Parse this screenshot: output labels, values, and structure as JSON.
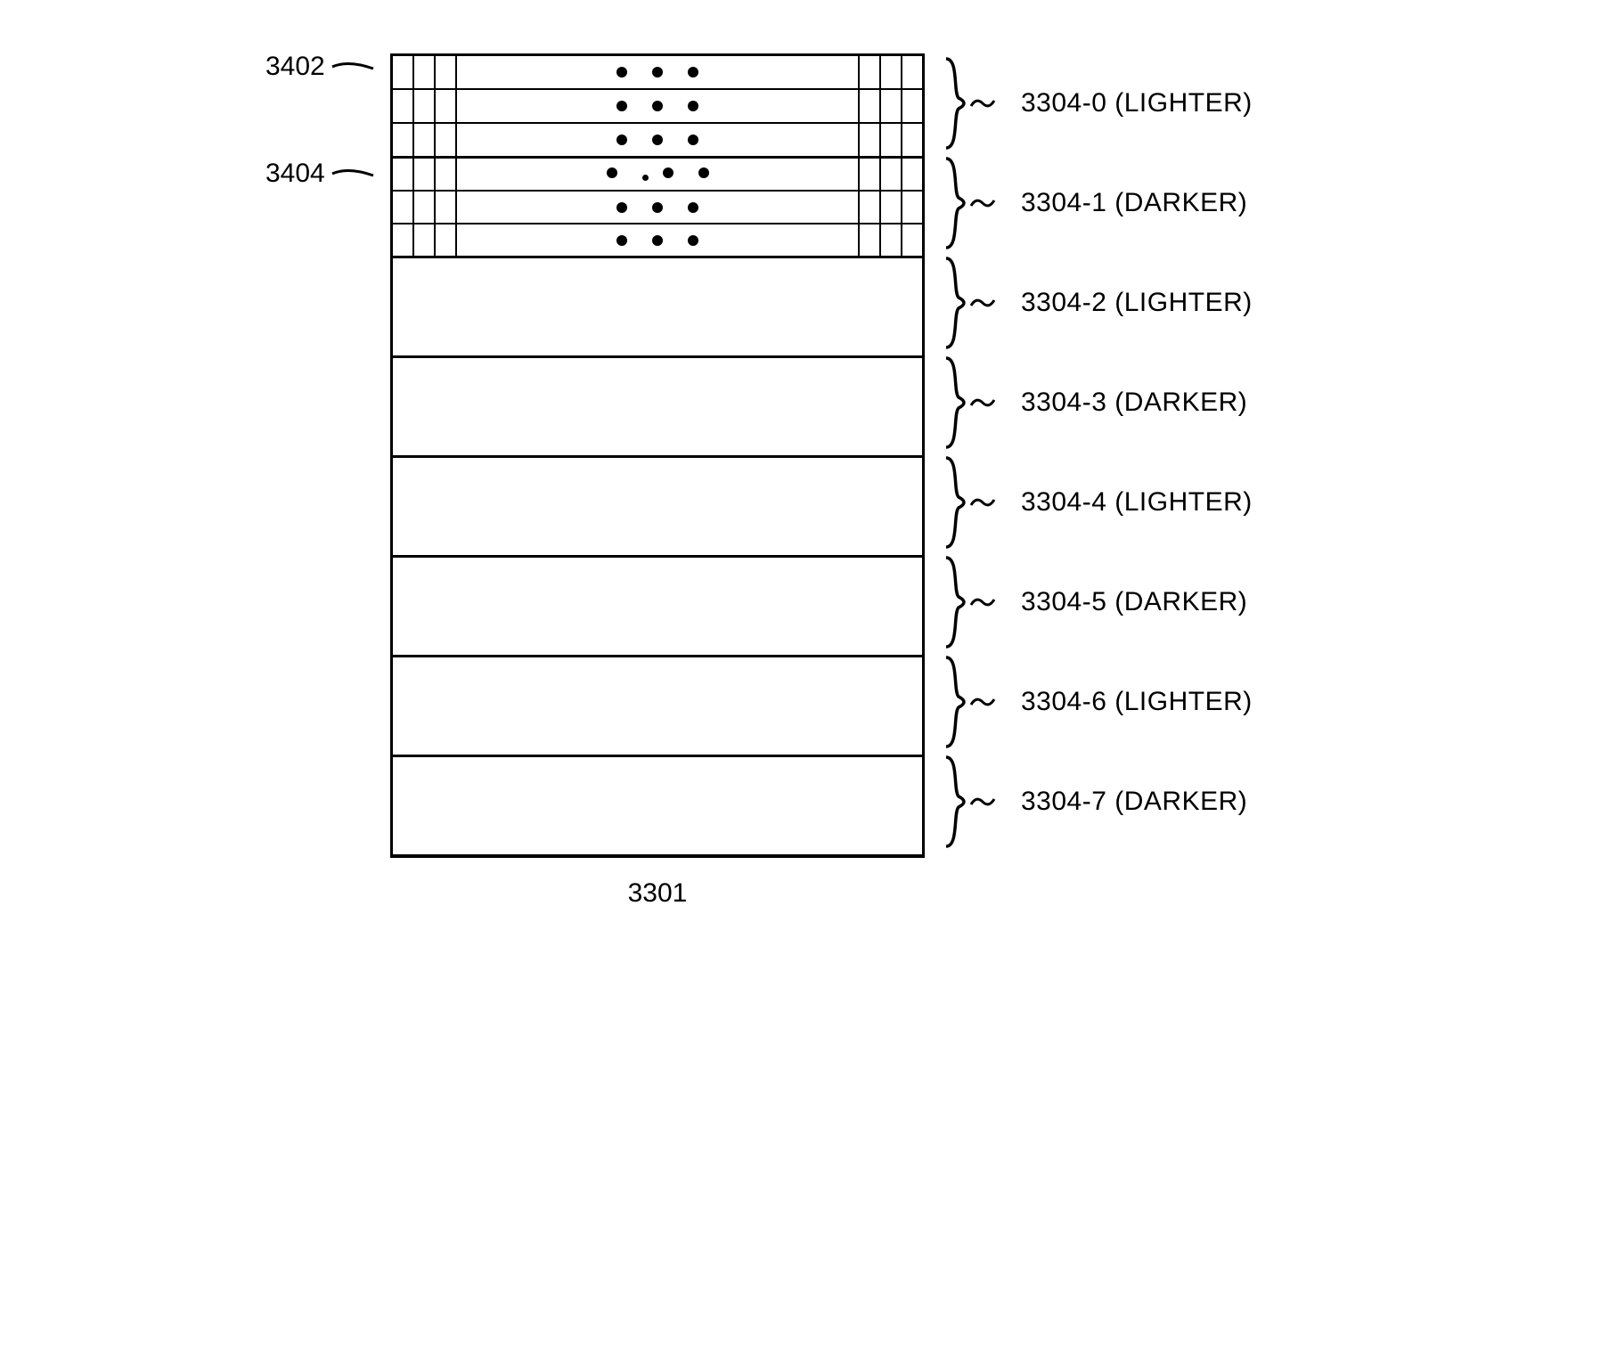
{
  "labels": {
    "left": [
      {
        "id": "3402",
        "text": "3402"
      },
      {
        "id": "3404",
        "text": "3404"
      }
    ],
    "bottom": "3301"
  },
  "bands": [
    {
      "id": "3304-0",
      "label": "3304-0",
      "tone": "LIGHTER",
      "detail": true
    },
    {
      "id": "3304-1",
      "label": "3304-1",
      "tone": "DARKER",
      "detail": true
    },
    {
      "id": "3304-2",
      "label": "3304-2",
      "tone": "LIGHTER",
      "detail": false
    },
    {
      "id": "3304-3",
      "label": "3304-3",
      "tone": "DARKER",
      "detail": false
    },
    {
      "id": "3304-4",
      "label": "3304-4",
      "tone": "LIGHTER",
      "detail": false
    },
    {
      "id": "3304-5",
      "label": "3304-5",
      "tone": "DARKER",
      "detail": false
    },
    {
      "id": "3304-6",
      "label": "3304-6",
      "tone": "LIGHTER",
      "detail": false
    },
    {
      "id": "3304-7",
      "label": "3304-7",
      "tone": "DARKER",
      "detail": false
    }
  ],
  "detail_rows_per_band": 3,
  "side_columns_per_side": 3,
  "dots_per_row": 3
}
